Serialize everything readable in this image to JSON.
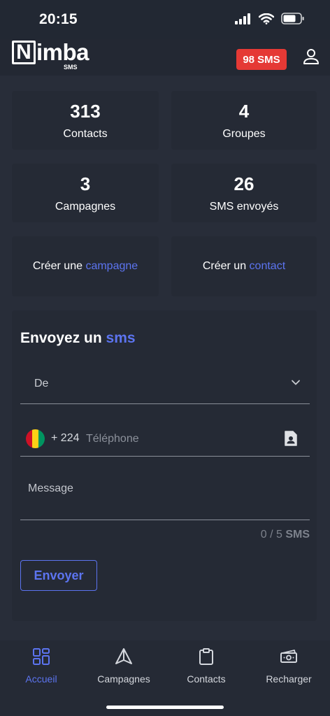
{
  "status_bar": {
    "time": "20:15"
  },
  "header": {
    "logo": {
      "initial": "N",
      "rest": "imba",
      "subtext": "SMS"
    },
    "sms_badge": "98 SMS",
    "user_icon": "user-icon"
  },
  "stats": [
    {
      "value": "313",
      "label": "Contacts"
    },
    {
      "value": "4",
      "label": "Groupes"
    },
    {
      "value": "3",
      "label": "Campagnes"
    },
    {
      "value": "26",
      "label": "SMS envoyés"
    }
  ],
  "actions": {
    "create_campaign": {
      "prefix": "Créer une ",
      "link": "campagne"
    },
    "create_contact": {
      "prefix": "Créer un ",
      "link": "contact"
    }
  },
  "send_sms": {
    "title_prefix": "Envoyez un ",
    "title_accent": "sms",
    "from_placeholder": "De",
    "country_code": "+ 224",
    "phone_placeholder": "Téléphone",
    "message_placeholder": "Message",
    "counter_value": "0 / 5",
    "counter_unit": "SMS",
    "send_label": "Envoyer"
  },
  "bottom_nav": [
    {
      "label": "Accueil",
      "icon": "dashboard-icon",
      "active": true
    },
    {
      "label": "Campagnes",
      "icon": "send-icon",
      "active": false
    },
    {
      "label": "Contacts",
      "icon": "clipboard-icon",
      "active": false
    },
    {
      "label": "Recharger",
      "icon": "money-icon",
      "active": false
    }
  ],
  "colors": {
    "accent": "#5c74f0",
    "badge": "#e53935",
    "background": "#282d39",
    "card": "#252a35"
  }
}
